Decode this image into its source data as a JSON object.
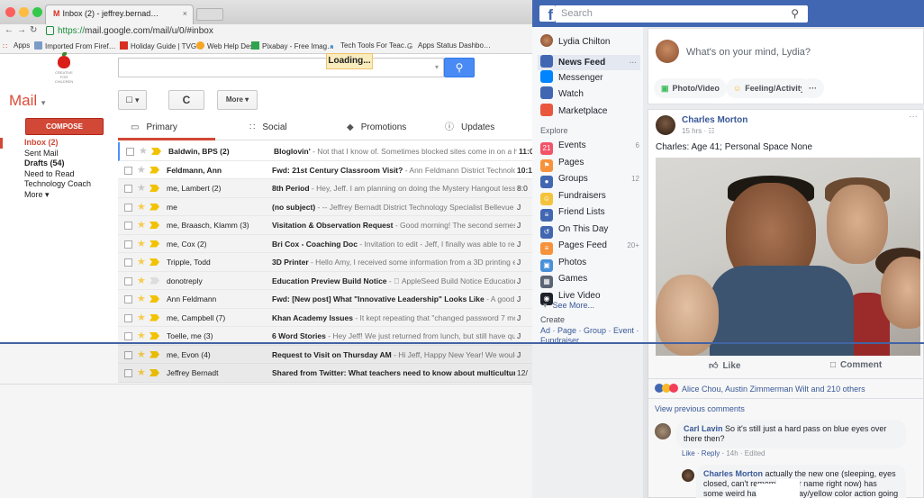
{
  "gmail": {
    "tab_title": "Inbox (2) - jeffrey.bernad…",
    "tab_icon": "M",
    "tab_close": "×",
    "url_host": "https://",
    "url_rest": "mail.google.com/mail/u/0/#inbox",
    "bookmarks": [
      "Apps",
      "Imported From Firef…",
      "Holiday Guide | TVG…",
      "Web Help Desk",
      "Pixabay - Free Imag…",
      "Tech Tools For Teac…",
      "Apps Status Dashbo…"
    ],
    "loading": "Loading...",
    "logo_text": "CREATIVE\nFOR\nCHILDREN",
    "mail_label": "Mail",
    "mail_caret": "▾",
    "toolbar": {
      "select": "☐ ▾",
      "refresh": "C",
      "more": "More ▾"
    },
    "compose": "COMPOSE",
    "nav": [
      {
        "label": "Inbox (2)",
        "style": "active"
      },
      {
        "label": "Sent Mail",
        "style": ""
      },
      {
        "label": "Drafts (54)",
        "style": "bold"
      },
      {
        "label": "Need to Read",
        "style": ""
      },
      {
        "label": "Technology Coach",
        "style": ""
      },
      {
        "label": "More ▾",
        "style": ""
      }
    ],
    "categories": [
      {
        "label": "Primary",
        "icon": "inbox-icon",
        "active": true
      },
      {
        "label": "Social",
        "icon": "people-icon",
        "active": false
      },
      {
        "label": "Promotions",
        "icon": "tag-icon",
        "active": false
      },
      {
        "label": "Updates",
        "icon": "info-icon",
        "active": false
      }
    ],
    "emails": [
      {
        "from": "Baldwin, BPS (2)",
        "subject": "Bloglovin'",
        "snippet": " - Not that I know of. Sometimes blocked sites come in on a hug",
        "date": "11:0",
        "unread": true,
        "starred": false,
        "important": true
      },
      {
        "from": "Feldmann, Ann",
        "subject": "Fwd: 21st Century Classroom Visit?",
        "snippet": " - Ann Feldmann District Technolog",
        "date": "10:1",
        "unread": true,
        "starred": false,
        "important": true
      },
      {
        "from": "me, Lambert (2)",
        "subject": "8th Period",
        "snippet": " - Hey, Jeff. I am planning on doing the Mystery Hangout lesson",
        "date": "8:0",
        "unread": false,
        "starred": false,
        "important": true
      },
      {
        "from": "me",
        "subject": "(no subject)",
        "snippet": " - -- Jeffrey Bernadt District Technology Specialist Bellevue Pu",
        "date": "J",
        "unread": false,
        "starred": true,
        "important": true
      },
      {
        "from": "me, Braasch, Klamm (3)",
        "subject": "Visitation & Observation Request",
        "snippet": " - Good morning! The second semester is",
        "date": "J",
        "unread": false,
        "starred": true,
        "important": true
      },
      {
        "from": "me, Cox (2)",
        "subject": "Bri Cox - Coaching Doc",
        "snippet": " - Invitation to edit - Jeff, I finally was able to read a",
        "date": "J",
        "unread": false,
        "starred": true,
        "important": true
      },
      {
        "from": "Tripple, Todd",
        "subject": "3D Printer",
        "snippet": " - Hello Amy, I received some information from a 3D printing exp",
        "date": "J",
        "unread": false,
        "starred": true,
        "important": true
      },
      {
        "from": "donotreply",
        "subject": "Education Preview Build Notice",
        "snippet": " -  AppleSeed Build Notice Education Pre",
        "date": "J",
        "unread": false,
        "starred": true,
        "important": false
      },
      {
        "from": "Ann Feldmann",
        "subject": "Fwd: [New post] What \"Innovative Leadership\" Looks Like",
        "snippet": " - A good read! >",
        "date": "J",
        "unread": false,
        "starred": true,
        "important": true
      },
      {
        "from": "me, Campbell (7)",
        "subject": "Khan Academy Issues",
        "snippet": " - It kept repeating that \"changed password 7 month",
        "date": "J",
        "unread": false,
        "starred": true,
        "important": true
      },
      {
        "from": "Toelle, me (3)",
        "subject": "6 Word Stories",
        "snippet": " - Hey Jeff! We just returned from lunch, but still have quite",
        "date": "J",
        "unread": false,
        "starred": true,
        "important": true
      },
      {
        "from": "me, Evon (4)",
        "subject": "Request to Visit on Thursday AM",
        "snippet": " - Hi Jeff, Happy New Year! We would lov",
        "date": "J",
        "unread": false,
        "starred": true,
        "important": true
      },
      {
        "from": "Jeffrey Bernadt",
        "subject": "Shared from Twitter: What teachers need to know about multicultural educ",
        "snippet": "",
        "date": "12/",
        "unread": false,
        "starred": true,
        "important": true
      }
    ]
  },
  "facebook": {
    "search_placeholder": "Search",
    "user": "Lydia Chilton",
    "nav": [
      {
        "label": "News Feed",
        "count": "···",
        "icon": "news-feed-icon",
        "color": "#4267b2",
        "active": true
      },
      {
        "label": "Messenger",
        "count": "",
        "icon": "messenger-icon",
        "color": "#0084ff"
      },
      {
        "label": "Watch",
        "count": "",
        "icon": "watch-icon",
        "color": "#4267b2"
      },
      {
        "label": "Marketplace",
        "count": "",
        "icon": "marketplace-icon",
        "color": "#e9573f"
      }
    ],
    "explore_heading": "Explore",
    "explore": [
      {
        "label": "Events",
        "count": "6",
        "icon": "events-icon",
        "color": "#f35369",
        "glyph": "21"
      },
      {
        "label": "Pages",
        "count": "",
        "icon": "pages-icon",
        "color": "#f7923b",
        "glyph": "⚑"
      },
      {
        "label": "Groups",
        "count": "12",
        "icon": "groups-icon",
        "color": "#4267b2",
        "glyph": "●"
      },
      {
        "label": "Fundraisers",
        "count": "",
        "icon": "fundraisers-icon",
        "color": "#f5c33b",
        "glyph": "☺"
      },
      {
        "label": "Friend Lists",
        "count": "",
        "icon": "friend-lists-icon",
        "color": "#4267b2",
        "glyph": "≡"
      },
      {
        "label": "On This Day",
        "count": "",
        "icon": "on-this-day-icon",
        "color": "#4267b2",
        "glyph": "↺"
      },
      {
        "label": "Pages Feed",
        "count": "20+",
        "icon": "pages-feed-icon",
        "color": "#f7923b",
        "glyph": "≡"
      },
      {
        "label": "Photos",
        "count": "",
        "icon": "photos-icon",
        "color": "#4a90d9",
        "glyph": "▣"
      },
      {
        "label": "Games",
        "count": "",
        "icon": "games-icon",
        "color": "#5b6475",
        "glyph": "▦"
      },
      {
        "label": "Live Video",
        "count": "",
        "icon": "live-video-icon",
        "color": "#1d2129",
        "glyph": "◉"
      }
    ],
    "see_more": "See More...",
    "create_heading": "Create",
    "create_links": "Ad · Page · Group · Event · Fundraiser",
    "composer_prompt": "What's on your mind, Lydia?",
    "composer_actions": [
      {
        "label": "Photo/Video",
        "glyph": "▣",
        "color": "#45bd62"
      },
      {
        "label": "Feeling/Activity",
        "glyph": "☺",
        "color": "#f7b928"
      },
      {
        "label": "···",
        "glyph": "",
        "color": "#606770"
      }
    ],
    "post": {
      "author": "Charles Morton",
      "time": "15 hrs · ☷",
      "more": "···",
      "text": "Charles: Age 41; Personal Space None",
      "like": "Like",
      "comment": "Comment",
      "reactions": "Alice Chou, Austin Zimmerman Wilt and 210 others",
      "view_previous": "View previous comments",
      "comment1_author": "Carl Lavin",
      "comment1_text": " So it's still just a hard pass on blue eyes over there then?",
      "comment1_links": "Like · Reply ·",
      "comment1_meta": " 14h · Edited",
      "comment2_author": "Charles Morton",
      "comment2_text": " actually the new one (sleeping, eyes closed, can't remember her name right now) has some weird hazel/green/gray/yellow color action going on"
    }
  },
  "colors": {
    "gmail_red": "#d14836",
    "fb_blue": "#4267b2",
    "fb_link": "#385898",
    "star": "#f7cb4d",
    "important": "#f2c200"
  }
}
